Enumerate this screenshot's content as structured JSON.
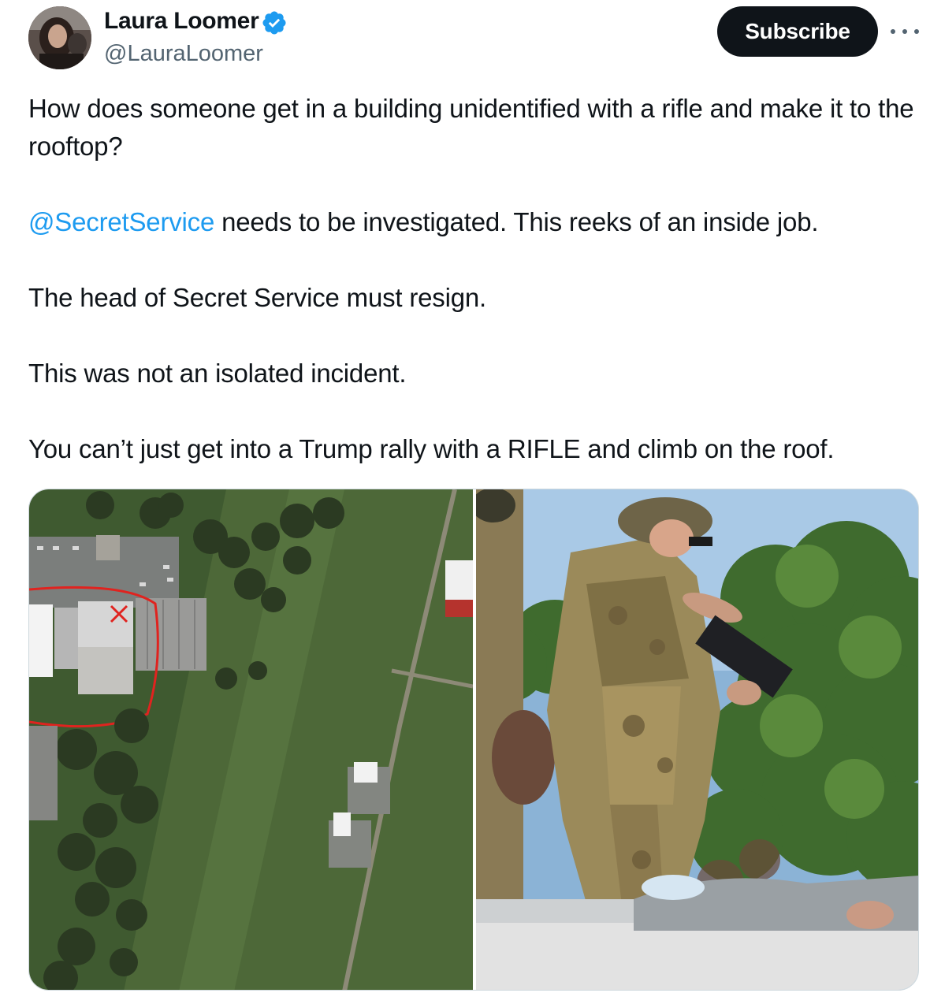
{
  "author": {
    "name": "Laura Loomer",
    "handle": "@LauraLoomer",
    "verified": true,
    "avatar_icon": "avatar-photo",
    "verified_icon": "verified-badge-icon"
  },
  "actions": {
    "subscribe_label": "Subscribe",
    "more_icon": "more-options-icon"
  },
  "tweet": {
    "line1": "How does someone get in a building unidentified with a rifle and make it to the rooftop?",
    "mention": "@SecretService",
    "line2_rest": " needs to be investigated. This reeks of an inside job.",
    "line3": "The head of Secret Service must resign.",
    "line4": "This was not an isolated incident.",
    "line5": "You can’t just get into a Trump rally with a RIFLE and climb on the roof."
  },
  "media": {
    "count": 2
  },
  "colors": {
    "text": "#0f1419",
    "secondary": "#536471",
    "link": "#1d9bf0",
    "verified": "#1d9bf0",
    "button": "#0f1419",
    "annotation": "#e0231f"
  }
}
